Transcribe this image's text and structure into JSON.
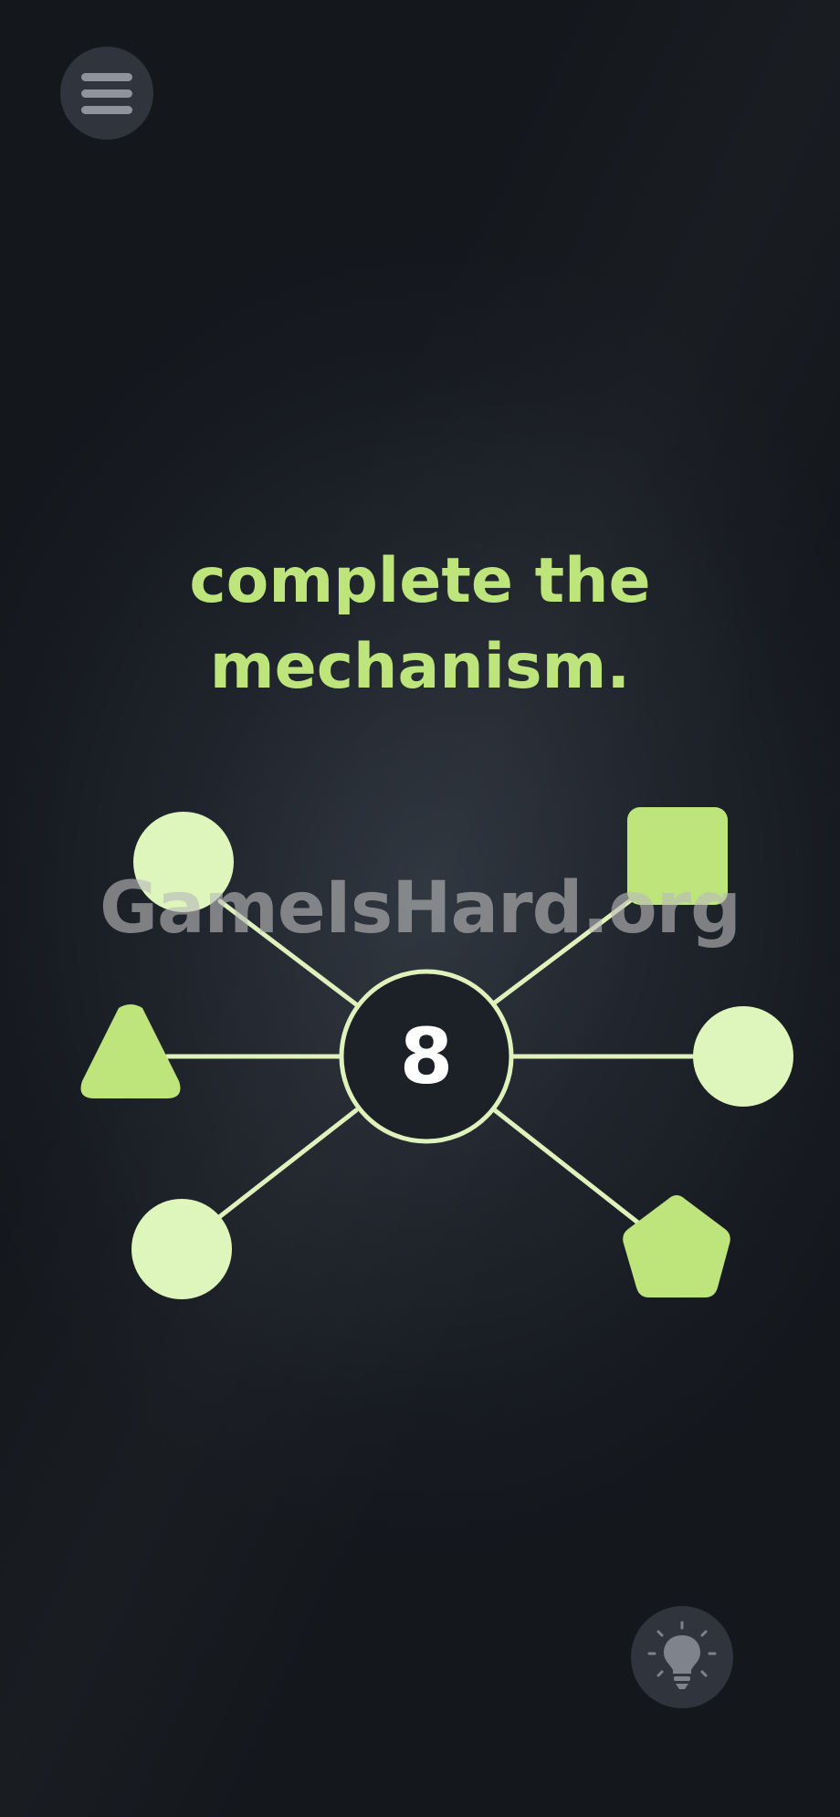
{
  "title": {
    "line1": "complete the",
    "line2": "mechanism."
  },
  "center": {
    "value": "8"
  },
  "watermark": "GameIsHard.org",
  "nodes": [
    {
      "name": "top-left",
      "shape": "circle",
      "color": "#def5bb"
    },
    {
      "name": "top-right",
      "shape": "square",
      "color": "#bde57c"
    },
    {
      "name": "left",
      "shape": "triangle",
      "color": "#bde57c"
    },
    {
      "name": "right",
      "shape": "circle",
      "color": "#def5bb"
    },
    {
      "name": "bottom-left",
      "shape": "circle",
      "color": "#def5bb"
    },
    {
      "name": "bottom-right",
      "shape": "pentagon",
      "color": "#bde57c"
    }
  ],
  "icons": {
    "menu": "hamburger-menu-icon",
    "hint": "lightbulb-icon"
  },
  "colors": {
    "accent": "#bde57c",
    "light_node": "#def5bb",
    "connector": "#dff2bc",
    "background": "#1b1f26"
  }
}
